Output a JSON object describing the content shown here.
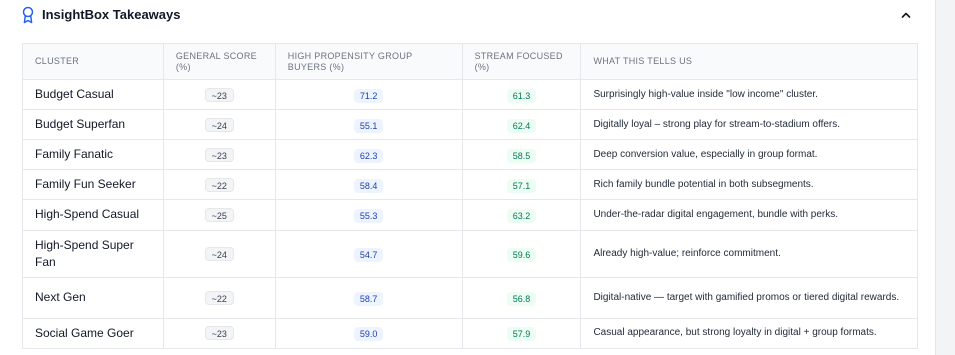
{
  "header": {
    "title": "InsightBox Takeaways",
    "award_icon": "award-icon",
    "collapse_icon": "chevron-up-icon"
  },
  "colors": {
    "accent_blue": "#2563eb",
    "pill_blue_bg": "#eef4ff",
    "pill_green_bg": "#ecfdf3"
  },
  "table": {
    "headers": [
      "CLUSTER",
      "GENERAL SCORE (%)",
      "HIGH PROPENSITY GROUP BUYERS (%)",
      "STREAM FOCUSED (%)",
      "WHAT THIS TELLS US"
    ],
    "rows": [
      {
        "cluster": "Budget Casual",
        "general": "~23",
        "hp": "71.2",
        "stream": "61.3",
        "what": "Surprisingly high-value inside \"low income\" cluster."
      },
      {
        "cluster": "Budget Superfan",
        "general": "~24",
        "hp": "55.1",
        "stream": "62.4",
        "what": "Digitally loyal – strong play for stream-to-stadium offers."
      },
      {
        "cluster": "Family Fanatic",
        "general": "~23",
        "hp": "62.3",
        "stream": "58.5",
        "what": "Deep conversion value, especially in group format."
      },
      {
        "cluster": "Family Fun Seeker",
        "general": "~22",
        "hp": "58.4",
        "stream": "57.1",
        "what": "Rich family bundle potential in both subsegments."
      },
      {
        "cluster": "High-Spend Casual",
        "general": "~25",
        "hp": "55.3",
        "stream": "63.2",
        "what": "Under-the-radar digital engagement, bundle with perks."
      },
      {
        "cluster": "High-Spend Super Fan",
        "general": "~24",
        "hp": "54.7",
        "stream": "59.6",
        "what": "Already high-value; reinforce commitment."
      },
      {
        "cluster": "Next Gen",
        "general": "~22",
        "hp": "58.7",
        "stream": "56.8",
        "what": "Digital-native — target with gamified promos or tiered digital rewards."
      },
      {
        "cluster": "Social Game Goer",
        "general": "~23",
        "hp": "59.0",
        "stream": "57.9",
        "what": "Casual appearance, but strong loyalty in digital + group formats."
      }
    ]
  }
}
